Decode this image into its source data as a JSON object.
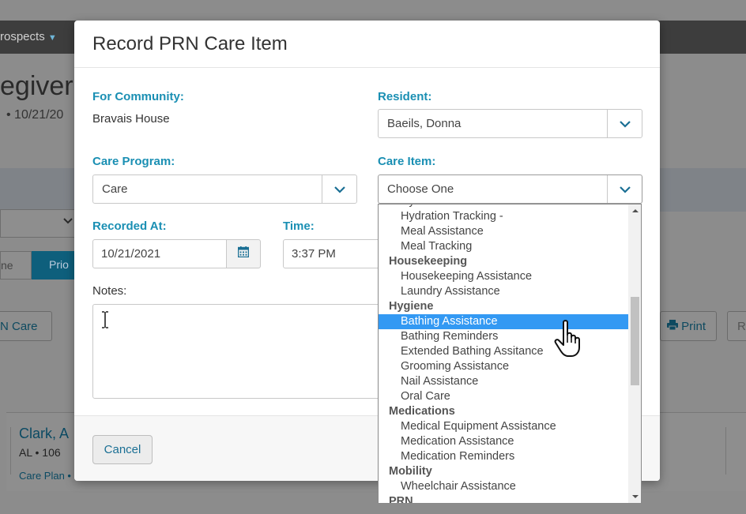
{
  "background": {
    "nav_text": "rospects",
    "heading": "egiver",
    "subheading": "• 10/21/20",
    "tab_left": "ne",
    "tab_active": "Prio",
    "prn_button": "N Care",
    "print_button": "Print",
    "print_button_2": "R",
    "card": {
      "name": "Clark, A",
      "meta": "AL  • 106",
      "link": "Care Plan  •"
    }
  },
  "modal": {
    "title": "Record PRN Care Item",
    "community_label": "For Community:",
    "community_value": "Bravais House",
    "resident_label": "Resident:",
    "resident_value": "Baeils, Donna",
    "care_program_label": "Care Program:",
    "care_program_value": "Care",
    "care_item_label": "Care Item:",
    "care_item_value": "Choose One",
    "recorded_at_label": "Recorded At:",
    "recorded_at_value": "10/21/2021",
    "time_label": "Time:",
    "time_value": "3:37 PM",
    "notes_label": "Notes:",
    "cancel_label": "Cancel"
  },
  "dropdown": {
    "items": [
      {
        "type": "item",
        "label": "Hydration Assistance"
      },
      {
        "type": "item",
        "label": "Hydration Tracking -"
      },
      {
        "type": "item",
        "label": "Meal Assistance"
      },
      {
        "type": "item",
        "label": "Meal Tracking"
      },
      {
        "type": "group",
        "label": "Housekeeping"
      },
      {
        "type": "item",
        "label": "Housekeeping Assistance"
      },
      {
        "type": "item",
        "label": "Laundry Assistance"
      },
      {
        "type": "group",
        "label": "Hygiene"
      },
      {
        "type": "item",
        "label": "Bathing Assistance",
        "selected": true
      },
      {
        "type": "item",
        "label": "Bathing Reminders"
      },
      {
        "type": "item",
        "label": "Extended Bathing Assitance"
      },
      {
        "type": "item",
        "label": "Grooming Assistance"
      },
      {
        "type": "item",
        "label": "Nail Assistance"
      },
      {
        "type": "item",
        "label": "Oral Care"
      },
      {
        "type": "group",
        "label": "Medications"
      },
      {
        "type": "item",
        "label": "Medical Equipment Assistance"
      },
      {
        "type": "item",
        "label": "Medication Assistance"
      },
      {
        "type": "item",
        "label": "Medication Reminders"
      },
      {
        "type": "group",
        "label": "Mobility"
      },
      {
        "type": "item",
        "label": "Wheelchair Assistance"
      },
      {
        "type": "group",
        "label": "PRN"
      }
    ]
  },
  "colors": {
    "label_accent": "#1a8fb3",
    "selected_item": "#3399f3",
    "chevron": "#1a6f94"
  },
  "icons": {
    "select_toggle": "chevron-down-icon",
    "date_picker": "calendar-icon",
    "cursor": "hand-pointer-icon",
    "text_cursor": "i-beam-icon"
  }
}
